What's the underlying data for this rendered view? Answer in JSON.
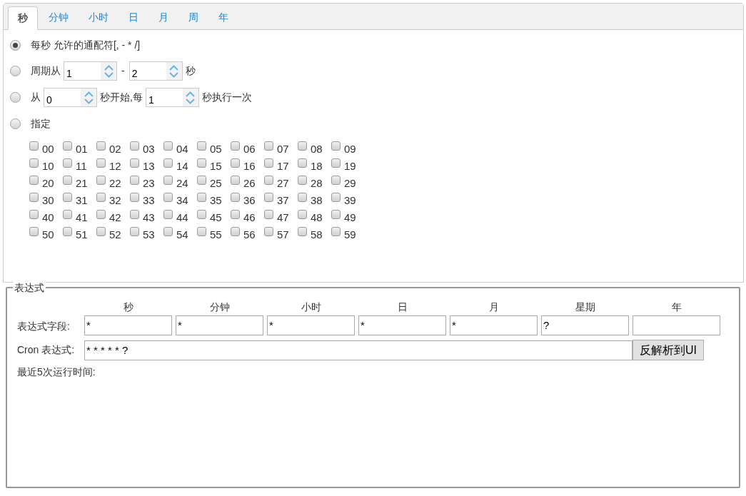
{
  "tabs": [
    {
      "label": "秒",
      "selected": true
    },
    {
      "label": "分钟",
      "selected": false
    },
    {
      "label": "小时",
      "selected": false
    },
    {
      "label": "日",
      "selected": false
    },
    {
      "label": "月",
      "selected": false
    },
    {
      "label": "周",
      "selected": false
    },
    {
      "label": "年",
      "selected": false
    }
  ],
  "options": [
    {
      "kind": "text",
      "selected": true,
      "label": "每秒 允许的通配符[, - * /]"
    },
    {
      "kind": "range",
      "selected": false,
      "label": "周期从",
      "from": "1",
      "separator": "-",
      "to": "2",
      "unit": "秒"
    },
    {
      "kind": "step",
      "selected": false,
      "label": "从",
      "start": "0",
      "middle": "秒开始,每",
      "step": "1",
      "end": "秒执行一次"
    },
    {
      "kind": "specify",
      "selected": false,
      "label": "指定"
    }
  ],
  "checkboxes": [
    {
      "label": "00",
      "checked": false
    },
    {
      "label": "01",
      "checked": false
    },
    {
      "label": "02",
      "checked": false
    },
    {
      "label": "03",
      "checked": false
    },
    {
      "label": "04",
      "checked": false
    },
    {
      "label": "05",
      "checked": false
    },
    {
      "label": "06",
      "checked": false
    },
    {
      "label": "07",
      "checked": false
    },
    {
      "label": "08",
      "checked": false
    },
    {
      "label": "09",
      "checked": false
    },
    {
      "label": "10",
      "checked": false
    },
    {
      "label": "11",
      "checked": false
    },
    {
      "label": "12",
      "checked": false
    },
    {
      "label": "13",
      "checked": false
    },
    {
      "label": "14",
      "checked": false
    },
    {
      "label": "15",
      "checked": false
    },
    {
      "label": "16",
      "checked": false
    },
    {
      "label": "17",
      "checked": false
    },
    {
      "label": "18",
      "checked": false
    },
    {
      "label": "19",
      "checked": false
    },
    {
      "label": "20",
      "checked": false
    },
    {
      "label": "21",
      "checked": false
    },
    {
      "label": "22",
      "checked": false
    },
    {
      "label": "23",
      "checked": false
    },
    {
      "label": "24",
      "checked": false
    },
    {
      "label": "25",
      "checked": false
    },
    {
      "label": "26",
      "checked": false
    },
    {
      "label": "27",
      "checked": false
    },
    {
      "label": "28",
      "checked": false
    },
    {
      "label": "29",
      "checked": false
    },
    {
      "label": "30",
      "checked": false
    },
    {
      "label": "31",
      "checked": false
    },
    {
      "label": "32",
      "checked": false
    },
    {
      "label": "33",
      "checked": false
    },
    {
      "label": "34",
      "checked": false
    },
    {
      "label": "35",
      "checked": false
    },
    {
      "label": "36",
      "checked": false
    },
    {
      "label": "37",
      "checked": false
    },
    {
      "label": "38",
      "checked": false
    },
    {
      "label": "39",
      "checked": false
    },
    {
      "label": "40",
      "checked": false
    },
    {
      "label": "41",
      "checked": false
    },
    {
      "label": "42",
      "checked": false
    },
    {
      "label": "43",
      "checked": false
    },
    {
      "label": "44",
      "checked": false
    },
    {
      "label": "45",
      "checked": false
    },
    {
      "label": "46",
      "checked": false
    },
    {
      "label": "47",
      "checked": false
    },
    {
      "label": "48",
      "checked": false
    },
    {
      "label": "49",
      "checked": false
    },
    {
      "label": "50",
      "checked": false
    },
    {
      "label": "51",
      "checked": false
    },
    {
      "label": "52",
      "checked": false
    },
    {
      "label": "53",
      "checked": false
    },
    {
      "label": "54",
      "checked": false
    },
    {
      "label": "55",
      "checked": false
    },
    {
      "label": "56",
      "checked": false
    },
    {
      "label": "57",
      "checked": false
    },
    {
      "label": "58",
      "checked": false
    },
    {
      "label": "59",
      "checked": false
    }
  ],
  "expression": {
    "legend": "表达式",
    "fields_label": "表达式字段:",
    "fields": [
      {
        "header": "秒",
        "value": "*"
      },
      {
        "header": "分钟",
        "value": "*"
      },
      {
        "header": "小时",
        "value": "*"
      },
      {
        "header": "日",
        "value": "*"
      },
      {
        "header": "月",
        "value": "*"
      },
      {
        "header": "星期",
        "value": "?"
      },
      {
        "header": "年"
      }
    ],
    "cron_label": "Cron 表达式:",
    "cron_value": "* * * * * ?",
    "parse_button": "反解析到UI",
    "recent_label": "最近5次运行时间:"
  }
}
